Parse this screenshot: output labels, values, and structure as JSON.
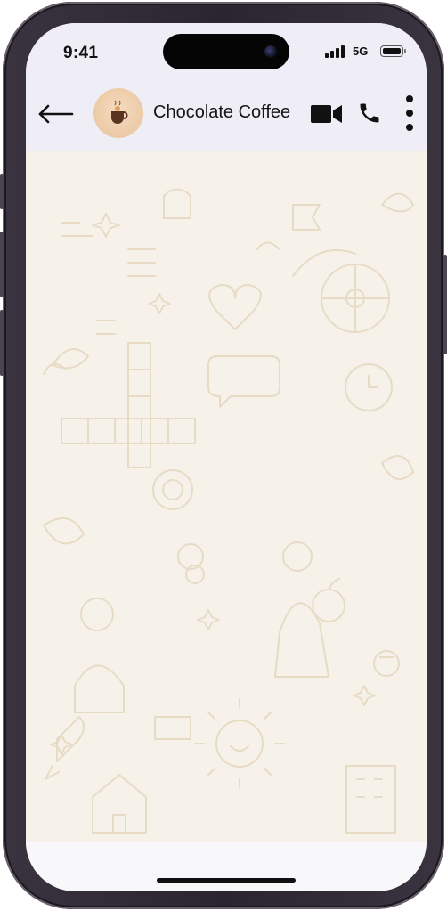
{
  "status_bar": {
    "time": "9:41",
    "network": "5G",
    "signal_icon": "cellular-signal-icon",
    "battery_icon": "battery-icon"
  },
  "header": {
    "back_icon": "back-arrow-icon",
    "contact_name": "Chocolate Coffee",
    "avatar_icon": "coffee-cup-icon",
    "actions": [
      "video-call-icon",
      "phone-call-icon",
      "more-options-icon"
    ]
  },
  "colors": {
    "header_bg": "#efedf5",
    "chat_bg": "#f6f2ea",
    "doodle": "#e9dcc8"
  }
}
